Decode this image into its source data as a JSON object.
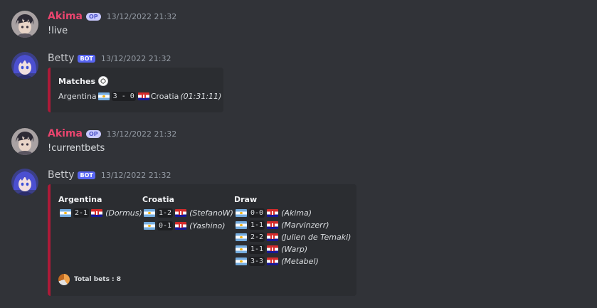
{
  "colors": {
    "background": "#313338",
    "akima_name": "#e9456e",
    "betty_name": "#c7c9cd",
    "bot_tag": "#5865f2",
    "embed_bg": "#2b2d31",
    "embed_accent": "#ad1a38"
  },
  "messages": [
    {
      "author": "Akima",
      "tag": "OP",
      "time": "13/12/2022 21:32",
      "text": "!live"
    },
    {
      "author": "Betty",
      "tag": "BOT",
      "time": "13/12/2022 21:32",
      "embed": {
        "title": "Matches",
        "title_icon": "soccer-ball-icon",
        "team1": "Argentina",
        "score": "3 - 0",
        "team2": "Croatia",
        "elapsed": "(01:31:11)"
      }
    },
    {
      "author": "Akima",
      "tag": "OP",
      "time": "13/12/2022 21:32",
      "text": "!currentbets"
    },
    {
      "author": "Betty",
      "tag": "BOT",
      "time": "13/12/2022 21:32",
      "embed": {
        "columns": [
          {
            "header": "Argentina",
            "bets": [
              {
                "score": "2-1",
                "user": "(Dormus)"
              }
            ]
          },
          {
            "header": "Croatia",
            "bets": [
              {
                "score": "1-2",
                "user": "(StefanoW)"
              },
              {
                "score": "0-1",
                "user": "(Yashino)"
              }
            ]
          },
          {
            "header": "Draw",
            "bets": [
              {
                "score": "0-0",
                "user": "(Akima)"
              },
              {
                "score": "1-1",
                "user": "(Marvinzerr)"
              },
              {
                "score": "2-2",
                "user": "(Julien de Temaki)"
              },
              {
                "score": "1-1",
                "user": "(Warp)"
              },
              {
                "score": "3-3",
                "user": "(Metabel)"
              }
            ]
          }
        ],
        "footer": "Total bets : 8",
        "footer_icon": "football-icon"
      }
    }
  ]
}
